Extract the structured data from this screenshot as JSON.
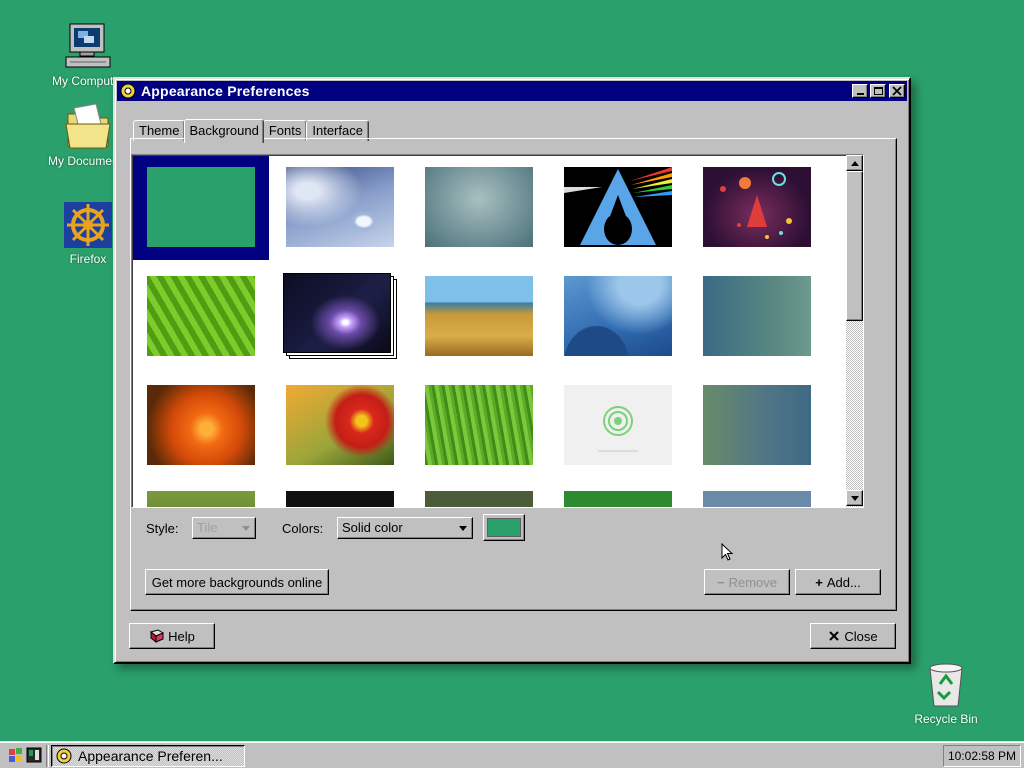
{
  "desktop": {
    "icons": [
      {
        "label": "My Computer",
        "icon": "my-computer-icon"
      },
      {
        "label": "My Documents",
        "icon": "folder-icon"
      },
      {
        "label": "Firefox",
        "icon": "firefox-icon"
      },
      {
        "label": "Recycle Bin",
        "icon": "recycle-bin-icon"
      }
    ],
    "background_color": "#2aa06c"
  },
  "window": {
    "title": "Appearance Preferences",
    "tabs": [
      {
        "label": "Theme",
        "active": false
      },
      {
        "label": "Background",
        "active": true
      },
      {
        "label": "Fonts",
        "active": false
      },
      {
        "label": "Interface",
        "active": false
      }
    ],
    "backgrounds": {
      "selected_index": 0,
      "thumbnails": [
        "solid-green",
        "water-drop",
        "blue-gradient",
        "arch-prism",
        "space-bubbles",
        "green-leaf",
        "comet",
        "dry-grass",
        "blue-waves",
        "teal-gradient",
        "orange-flower",
        "red-flower",
        "green-grass",
        "white-logo",
        "steel-gradient"
      ]
    },
    "style": {
      "label": "Style:",
      "value": "Tile",
      "disabled": true
    },
    "colors": {
      "label": "Colors:",
      "value": "Solid color",
      "swatch": "#2aa06c"
    },
    "buttons": {
      "online": "Get more backgrounds online",
      "remove": "Remove",
      "add": "Add...",
      "help": "Help",
      "close": "Close"
    }
  },
  "taskbar": {
    "task_label": "Appearance Preferen...",
    "clock": "10:02:58 PM"
  }
}
